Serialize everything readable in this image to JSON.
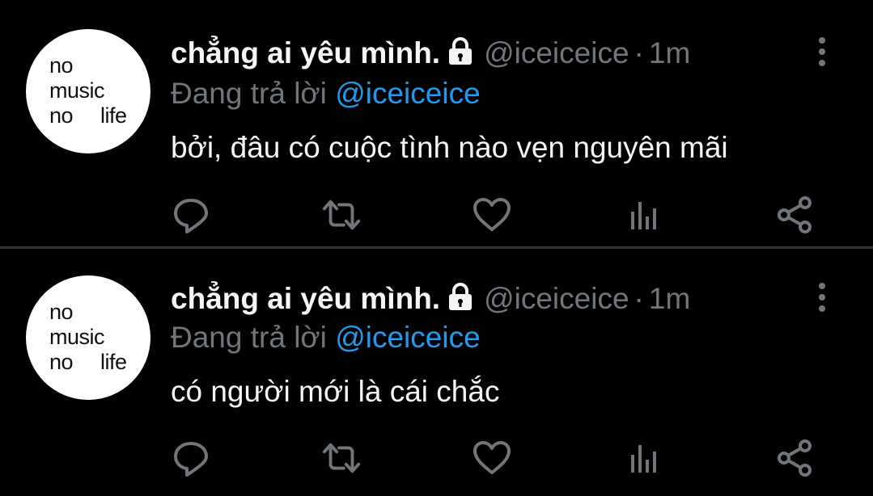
{
  "colors": {
    "background": "#000000",
    "divider": "#2f3336",
    "text_primary": "#f5f5f5",
    "text_secondary": "#71767b",
    "mention": "#1d9bf0",
    "icon": "#71767b"
  },
  "tweets": [
    {
      "avatar": {
        "line1": "no",
        "line2": "music",
        "line3a": "no",
        "line3b": "life"
      },
      "display_name": "chẳng ai yêu mình.",
      "lock_icon": "lock-icon",
      "handle": "@iceiceice",
      "separator": "·",
      "time": "1m",
      "replying_prefix": "Đang trả lời",
      "replying_to": "@iceiceice",
      "text": "bởi, đâu có cuộc tình nào vẹn nguyên mãi",
      "actions": [
        "reply-icon",
        "retweet-icon",
        "like-icon",
        "analytics-icon",
        "share-icon"
      ]
    },
    {
      "avatar": {
        "line1": "no",
        "line2": "music",
        "line3a": "no",
        "line3b": "life"
      },
      "display_name": "chẳng ai yêu mình.",
      "lock_icon": "lock-icon",
      "handle": "@iceiceice",
      "separator": "·",
      "time": "1m",
      "replying_prefix": "Đang trả lời",
      "replying_to": "@iceiceice",
      "text": "có người mới là cái chắc",
      "actions": [
        "reply-icon",
        "retweet-icon",
        "like-icon",
        "analytics-icon",
        "share-icon"
      ]
    }
  ]
}
